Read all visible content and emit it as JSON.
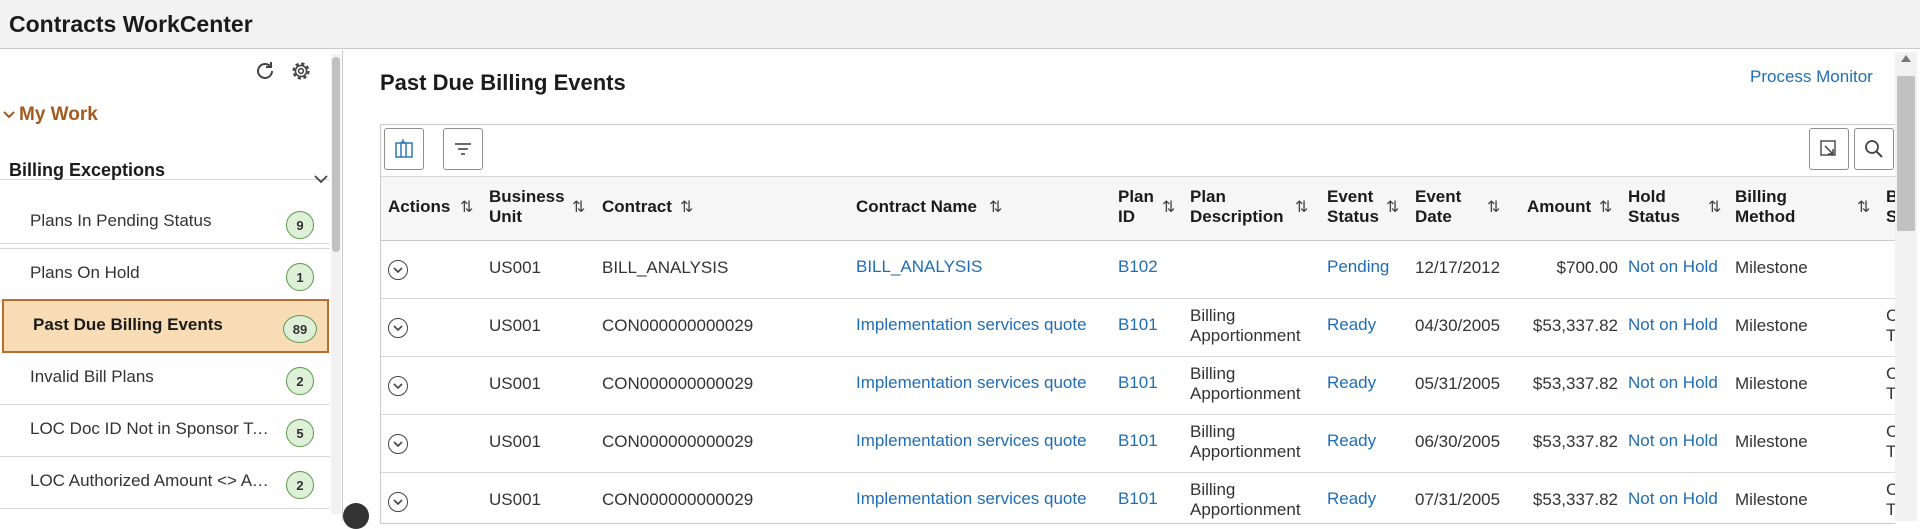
{
  "app": {
    "title": "Contracts WorkCenter"
  },
  "left_panel": {
    "section": "My Work",
    "group": "Billing Exceptions",
    "items": [
      {
        "label": "Plans In Pending Status",
        "count": "9",
        "selected": false
      },
      {
        "label": "Plans On Hold",
        "count": "1",
        "selected": false
      },
      {
        "label": "Past Due Billing Events",
        "count": "89",
        "selected": true
      },
      {
        "label": "Invalid Bill Plans",
        "count": "2",
        "selected": false
      },
      {
        "label": "LOC Doc ID Not in Sponsor Table",
        "count": "5",
        "selected": false
      },
      {
        "label": "LOC Authorized Amount <> Award Amount",
        "count": "2",
        "selected": false
      }
    ],
    "icons": [
      "refresh-icon",
      "gear-icon",
      "chevron-down-icon"
    ]
  },
  "main": {
    "title": "Past Due Billing Events",
    "process_monitor": "Process Monitor",
    "columns": {
      "actions": "Actions",
      "business_unit": [
        "Business",
        "Unit"
      ],
      "contract": "Contract",
      "contract_name": "Contract Name",
      "plan_id": [
        "Plan",
        "ID"
      ],
      "plan_description": [
        "Plan",
        "Description"
      ],
      "event_status": [
        "Event",
        "Status"
      ],
      "event_date": [
        "Event",
        "Date"
      ],
      "amount": "Amount",
      "hold_status": [
        "Hold",
        "Status"
      ],
      "billing_method": [
        "Billing",
        "Method"
      ],
      "next_col": [
        "B",
        "S"
      ]
    },
    "rows": [
      {
        "bu": "US001",
        "contract": "BILL_ANALYSIS",
        "name": "BILL_ANALYSIS",
        "plan": "B102",
        "desc": [
          "",
          ""
        ],
        "status": "Pending",
        "date": "12/17/2012",
        "amount": "$700.00",
        "hold": "Not on Hold",
        "method": "Milestone",
        "next": [
          "",
          ""
        ]
      },
      {
        "bu": "US001",
        "contract": "CON000000000029",
        "name": "Implementation services quote",
        "plan": "B101",
        "desc": [
          "Billing",
          "Apportionment"
        ],
        "status": "Ready",
        "date": "04/30/2005",
        "amount": "$53,337.82",
        "hold": "Not on Hold",
        "method": "Milestone",
        "next": [
          "C",
          "T"
        ]
      },
      {
        "bu": "US001",
        "contract": "CON000000000029",
        "name": "Implementation services quote",
        "plan": "B101",
        "desc": [
          "Billing",
          "Apportionment"
        ],
        "status": "Ready",
        "date": "05/31/2005",
        "amount": "$53,337.82",
        "hold": "Not on Hold",
        "method": "Milestone",
        "next": [
          "C",
          "T"
        ]
      },
      {
        "bu": "US001",
        "contract": "CON000000000029",
        "name": "Implementation services quote",
        "plan": "B101",
        "desc": [
          "Billing",
          "Apportionment"
        ],
        "status": "Ready",
        "date": "06/30/2005",
        "amount": "$53,337.82",
        "hold": "Not on Hold",
        "method": "Milestone",
        "next": [
          "C",
          "T"
        ]
      },
      {
        "bu": "US001",
        "contract": "CON000000000029",
        "name": "Implementation services quote",
        "plan": "B101",
        "desc": [
          "Billing",
          "Apportionment"
        ],
        "status": "Ready",
        "date": "07/31/2005",
        "amount": "$53,337.82",
        "hold": "Not on Hold",
        "method": "Milestone",
        "next": [
          "C",
          "T"
        ]
      }
    ],
    "sort_glyph": "⇅",
    "colors": {
      "link": "#1f6eb5",
      "selected_bg": "#f7dcb6",
      "selected_border": "#b86e2f",
      "badge_bg": "#dff0d8",
      "section_accent": "#a25b1f"
    }
  }
}
